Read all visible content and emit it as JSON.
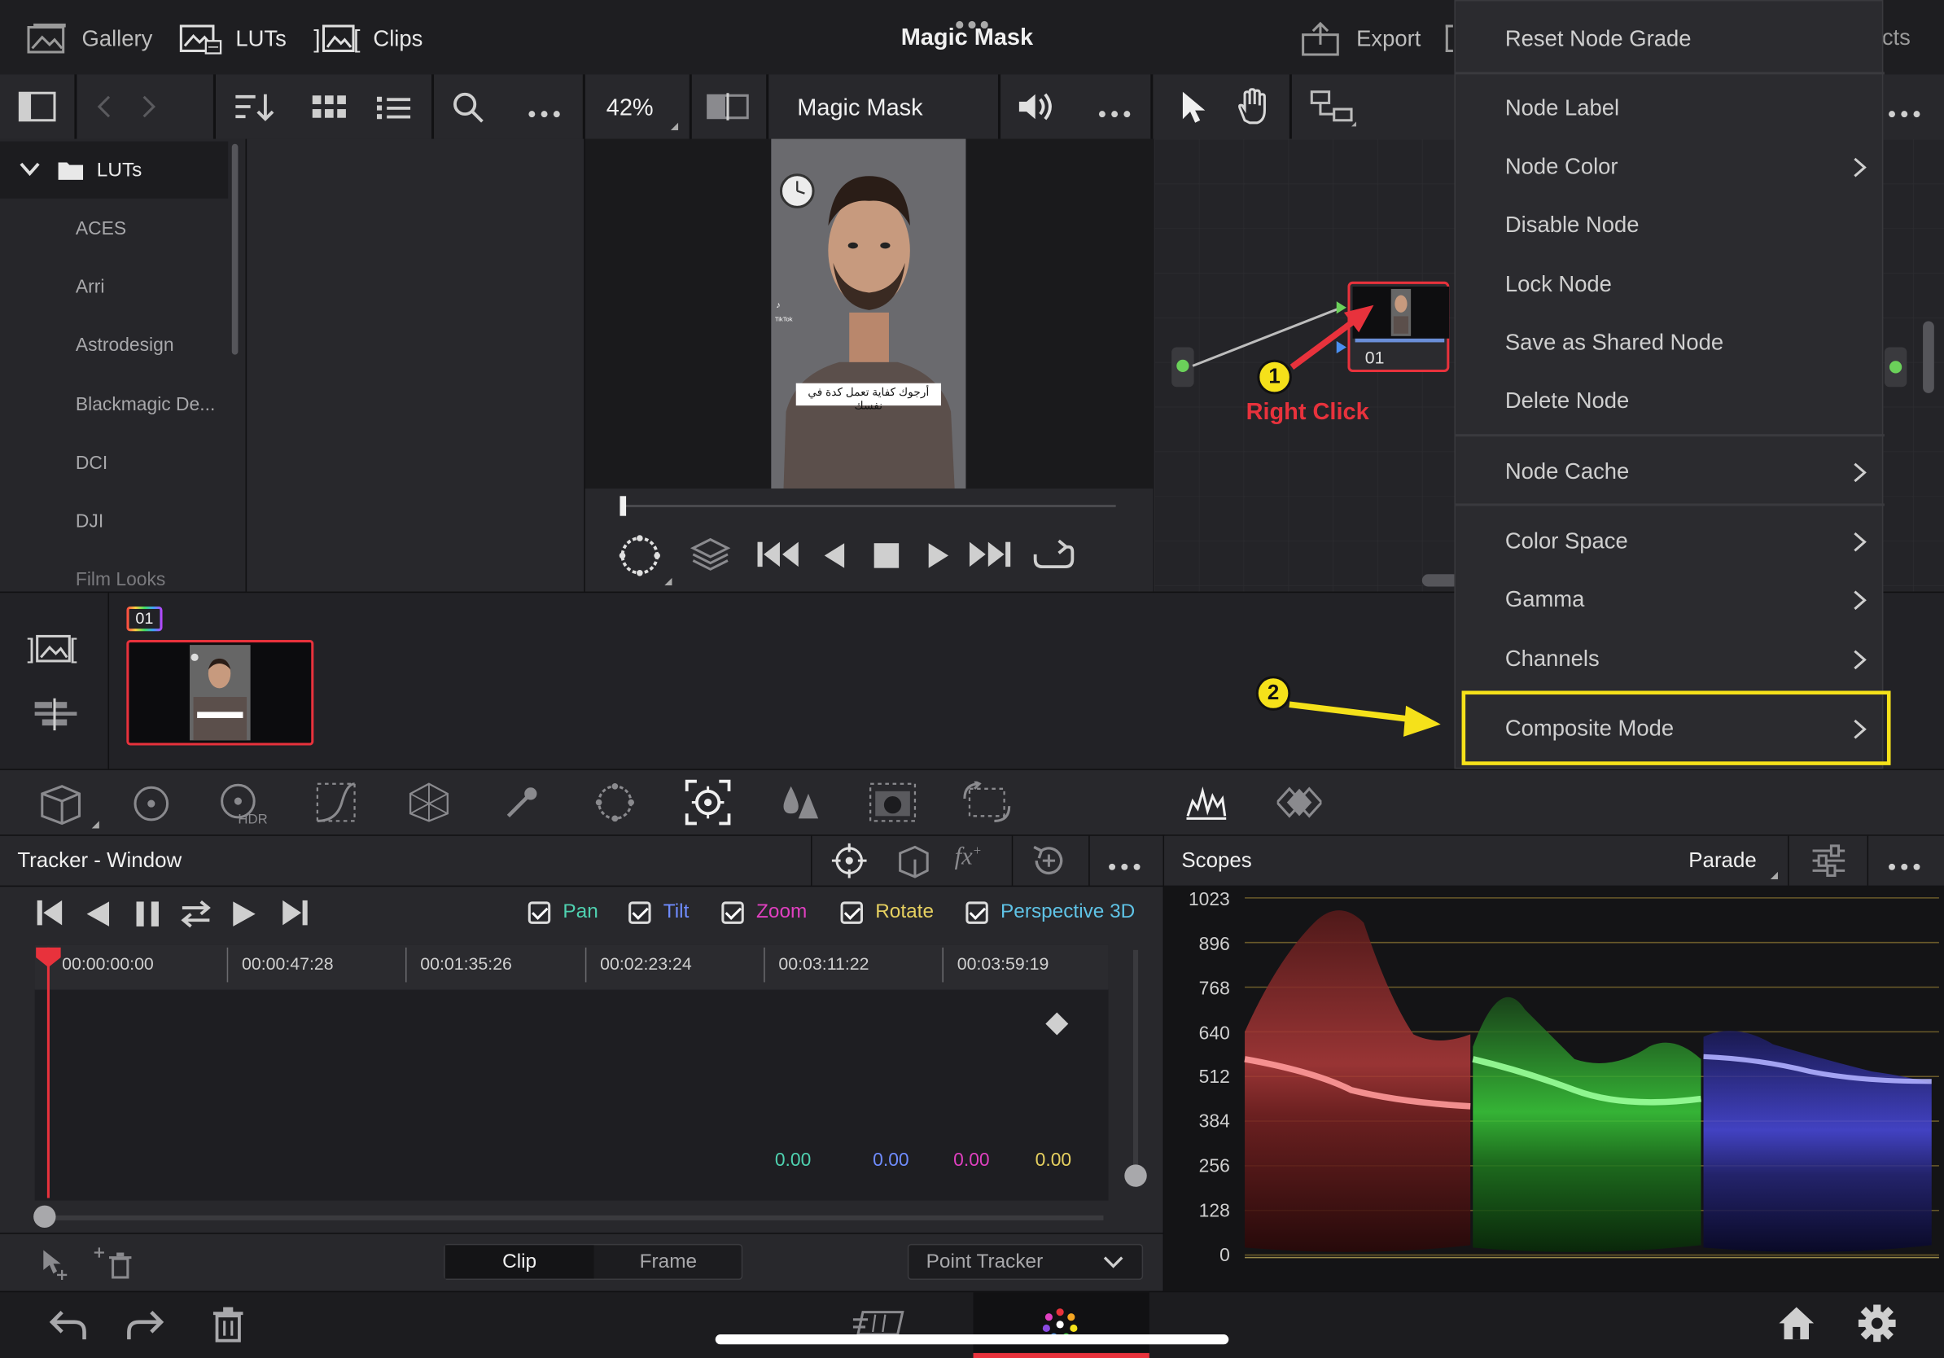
{
  "topbar": {
    "gallery": "Gallery",
    "luts": "LUTs",
    "clips": "Clips",
    "title": "Magic Mask",
    "export": "Export",
    "right_partial": "cts"
  },
  "toolbar": {
    "zoom": "42%",
    "viewer_title": "Magic Mask"
  },
  "lut_browser": {
    "root": "LUTs",
    "items": [
      "ACES",
      "Arri",
      "Astrodesign",
      "Blackmagic De...",
      "DCI",
      "DJI",
      "Film Looks"
    ]
  },
  "viewer": {
    "caption": "أرجوك كفاية تعمل كدة في نفسك"
  },
  "nodes": {
    "node_label": "01"
  },
  "annotations": {
    "step1": "1",
    "step1_text": "Right Click",
    "step2": "2",
    "step1_color": "#e8323c",
    "step2_color": "#f5e11a"
  },
  "context_menu": {
    "items": [
      {
        "label": "Reset Node Grade",
        "submenu": false
      },
      {
        "label": "Node Label",
        "submenu": false
      },
      {
        "label": "Node Color",
        "submenu": true
      },
      {
        "label": "Disable Node",
        "submenu": false
      },
      {
        "label": "Lock Node",
        "submenu": false
      },
      {
        "label": "Save as Shared Node",
        "submenu": false
      },
      {
        "label": "Delete Node",
        "submenu": false
      },
      {
        "label": "Node Cache",
        "submenu": true
      },
      {
        "label": "Color Space",
        "submenu": true
      },
      {
        "label": "Gamma",
        "submenu": true
      },
      {
        "label": "Channels",
        "submenu": true
      },
      {
        "label": "Composite Mode",
        "submenu": true
      }
    ]
  },
  "clip_strip": {
    "clip_badge": "01"
  },
  "tracker": {
    "title": "Tracker - Window",
    "checks": [
      {
        "label": "Pan",
        "color": "#4fd1b0"
      },
      {
        "label": "Tilt",
        "color": "#6f8cff"
      },
      {
        "label": "Zoom",
        "color": "#e040c0"
      },
      {
        "label": "Rotate",
        "color": "#e6d060"
      },
      {
        "label": "Perspective 3D",
        "color": "#5fc3e6"
      }
    ],
    "timecodes": [
      "00:00:00:00",
      "00:00:47:28",
      "00:01:35:26",
      "00:02:23:24",
      "00:03:11:22",
      "00:03:59:19"
    ],
    "values": [
      "0.00",
      "0.00",
      "0.00",
      "0.00"
    ],
    "seg_clip": "Clip",
    "seg_frame": "Frame",
    "dropdown": "Point Tracker"
  },
  "scopes": {
    "title": "Scopes",
    "mode": "Parade",
    "scale": [
      "1023",
      "896",
      "768",
      "640",
      "512",
      "384",
      "256",
      "128",
      "0"
    ]
  }
}
